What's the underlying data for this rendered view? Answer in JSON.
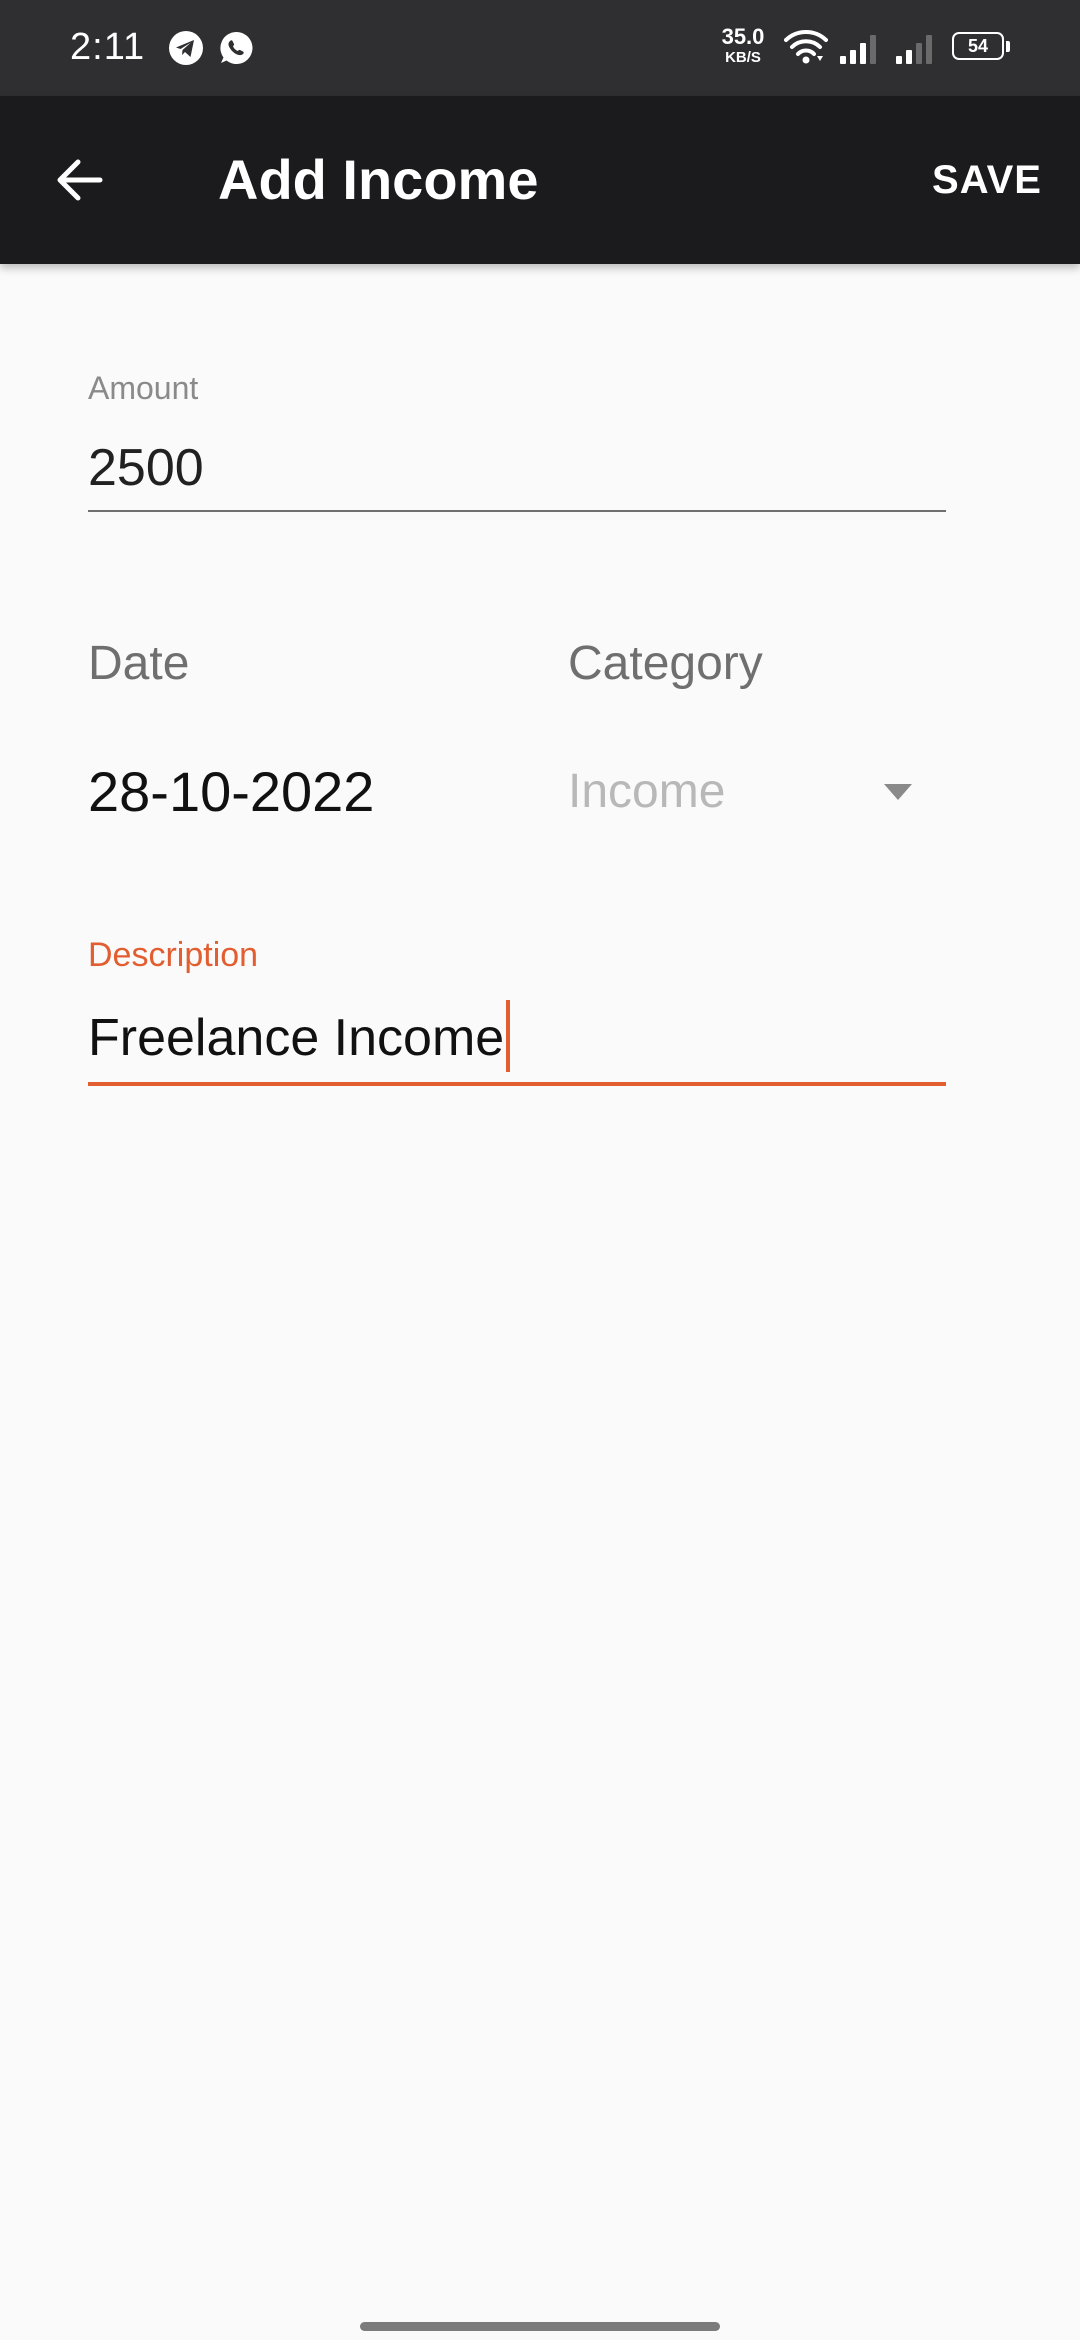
{
  "status_bar": {
    "time": "2:11",
    "network_speed_value": "35.0",
    "network_speed_unit": "KB/S",
    "battery_level": "54",
    "icons": [
      "telegram-icon",
      "whatsapp-icon",
      "wifi-icon",
      "signal-icon",
      "signal-icon",
      "battery-icon"
    ]
  },
  "app_bar": {
    "title": "Add Income",
    "save_label": "SAVE",
    "back_icon": "arrow-left-icon"
  },
  "form": {
    "amount": {
      "label": "Amount",
      "value": "2500"
    },
    "date": {
      "label": "Date",
      "value": "28-10-2022"
    },
    "category": {
      "label": "Category",
      "value": "Income",
      "icon": "dropdown-arrow-icon"
    },
    "description": {
      "label": "Description",
      "value": "Freelance Income"
    }
  },
  "colors": {
    "status_bar_bg": "#2f2f31",
    "app_bar_bg": "#1b1b1e",
    "accent": "#e25d30",
    "background": "#fafafa"
  }
}
